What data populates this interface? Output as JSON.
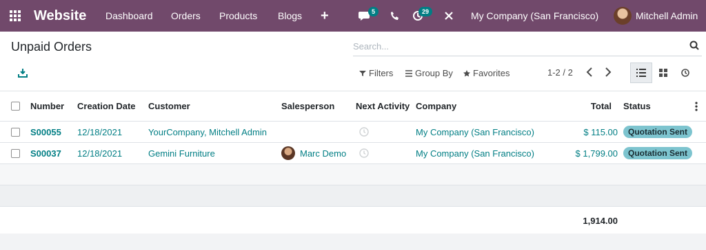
{
  "navbar": {
    "brand": "Website",
    "menu": [
      "Dashboard",
      "Orders",
      "Products",
      "Blogs"
    ],
    "plus": "+",
    "chat_count": "5",
    "activity_count": "29",
    "company": "My Company (San Francisco)",
    "user": "Mitchell Admin"
  },
  "control_panel": {
    "title": "Unpaid Orders",
    "search_placeholder": "Search...",
    "filters_label": "Filters",
    "group_by_label": "Group By",
    "favorites_label": "Favorites",
    "pager": "1-2 / 2"
  },
  "table": {
    "columns": [
      "Number",
      "Creation Date",
      "Customer",
      "Salesperson",
      "Next Activity",
      "Company",
      "Total",
      "Status"
    ],
    "rows": [
      {
        "number": "S00055",
        "date": "12/18/2021",
        "customer": "YourCompany, Mitchell Admin",
        "salesperson": "",
        "company": "My Company (San Francisco)",
        "total": "$ 115.00",
        "status": "Quotation Sent"
      },
      {
        "number": "S00037",
        "date": "12/18/2021",
        "customer": "Gemini Furniture",
        "salesperson": "Marc Demo",
        "company": "My Company (San Francisco)",
        "total": "$ 1,799.00",
        "status": "Quotation Sent"
      }
    ],
    "footer_total": "1,914.00"
  },
  "colors": {
    "navbar": "#71496b",
    "link": "#017e84",
    "badge": "#7dc4cf"
  },
  "icons": [
    "apps-grid-icon",
    "chat-icon",
    "phone-icon",
    "activity-icon",
    "tools-icon",
    "search-icon",
    "download-icon",
    "filter-icon",
    "group-by-icon",
    "star-icon",
    "chevron-left-icon",
    "chevron-right-icon",
    "list-view-icon",
    "kanban-view-icon",
    "activity-view-icon",
    "clock-icon",
    "kebab-icon"
  ]
}
